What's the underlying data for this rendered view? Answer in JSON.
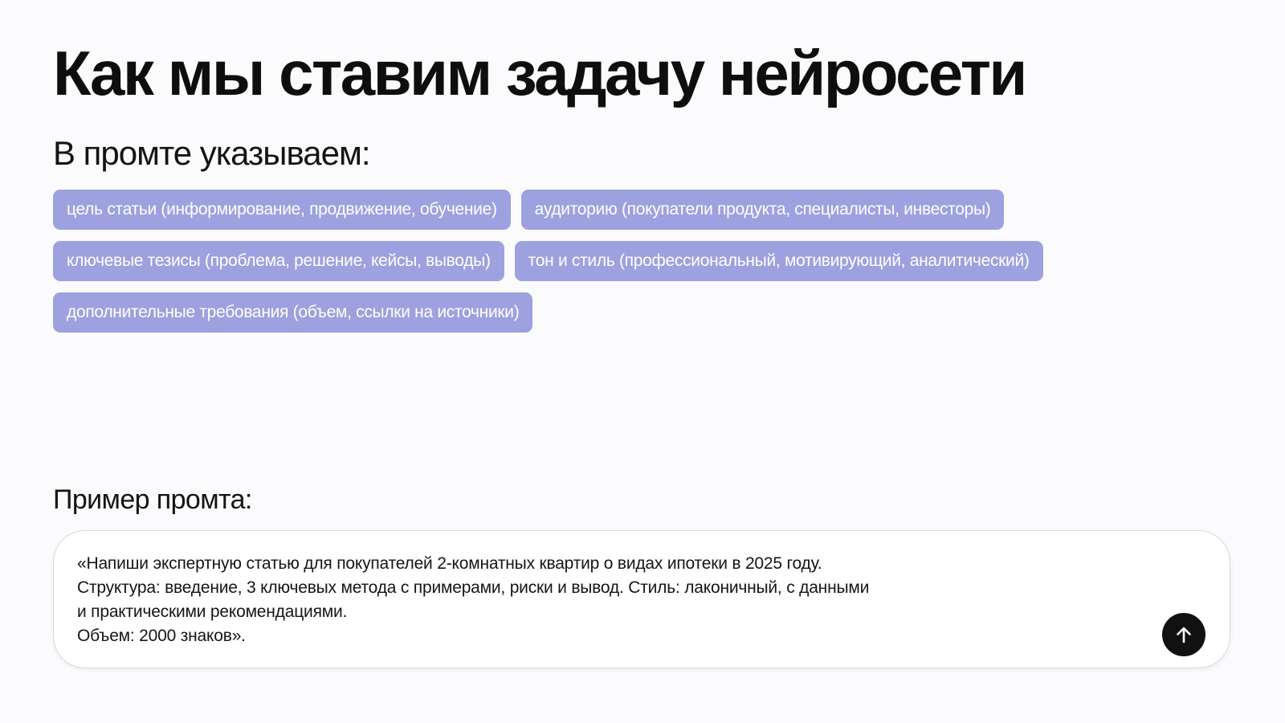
{
  "slide": {
    "title": "Как мы ставим задачу нейросети",
    "subtitle": "В промте указываем:",
    "tags": [
      [
        "цель статьи (информирование, продвижение, обучение)",
        "аудиторию (покупатели продукта, специалисты, инвесторы)"
      ],
      [
        "ключевые тезисы (проблема, решение, кейсы, выводы)",
        "тон и стиль (профессиональный, мотивирующий, аналитический)"
      ],
      [
        "дополнительные требования (объем, ссылки на источники)"
      ]
    ],
    "example_label": "Пример промта:",
    "prompt": {
      "lines": [
        "«Напиши экспертную статью для покупателей 2-комнатных квартир о видах ипотеки в 2025 году.",
        "Структура: введение, 3 ключевых метода с примерами, риски и вывод. Стиль: лаконичный, с данными",
        "и практическими рекомендациями.",
        "Объем: 2000 знаков»."
      ],
      "send_icon": "arrow-up-icon"
    },
    "colors": {
      "background": "#fbfbfd",
      "tag_background": "#9ea1df",
      "tag_text": "#ffffff",
      "send_button": "#111111"
    }
  }
}
